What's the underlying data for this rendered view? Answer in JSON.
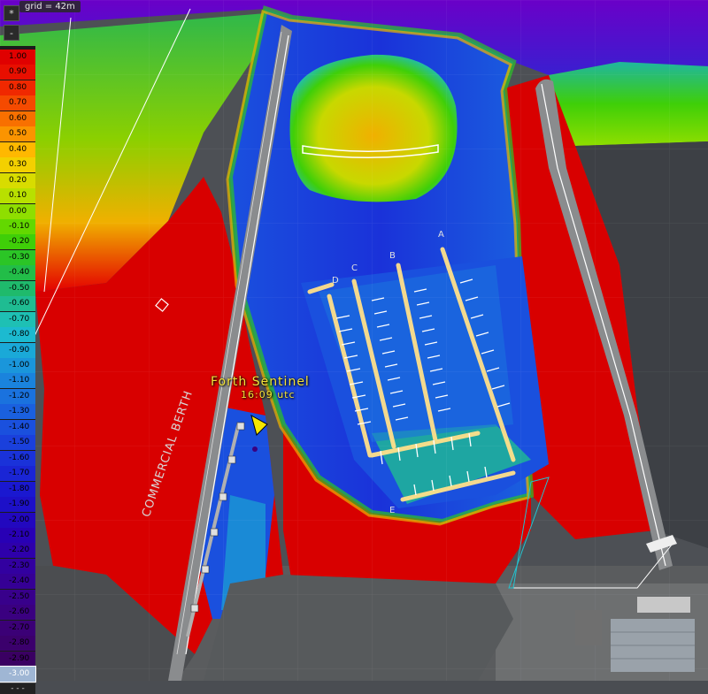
{
  "grid_label": "grid = 42m",
  "buttons": {
    "top": "*",
    "second": "-"
  },
  "legend": {
    "values": [
      "1.00",
      "0.90",
      "0.80",
      "0.70",
      "0.60",
      "0.50",
      "0.40",
      "0.30",
      "0.20",
      "0.10",
      "0.00",
      "-0.10",
      "-0.20",
      "-0.30",
      "-0.40",
      "-0.50",
      "-0.60",
      "-0.70",
      "-0.80",
      "-0.90",
      "-1.00",
      "-1.10",
      "-1.20",
      "-1.30",
      "-1.40",
      "-1.50",
      "-1.60",
      "-1.70",
      "-1.80",
      "-1.90",
      "-2.00",
      "-2.10",
      "-2.20",
      "-2.30",
      "-2.40",
      "-2.50",
      "-2.60",
      "-2.70",
      "-2.80",
      "-2.90",
      "-3.00"
    ],
    "colors": [
      "#e00000",
      "#e80f00",
      "#f02800",
      "#f54a00",
      "#f87000",
      "#fb9400",
      "#ffb800",
      "#f3d000",
      "#d8dc00",
      "#b8e000",
      "#8fde00",
      "#63d800",
      "#3fcf08",
      "#2bc526",
      "#22bd48",
      "#1fba6c",
      "#1fbc92",
      "#1ec0b4",
      "#1cbad0",
      "#1aa9d8",
      "#1a96db",
      "#1a83dd",
      "#1a72de",
      "#1a60df",
      "#1a50de",
      "#1a40dc",
      "#1a32d9",
      "#1a25d5",
      "#1a18d0",
      "#1d10c8",
      "#2208bf",
      "#2800b5",
      "#2e00ab",
      "#3200a0",
      "#350095",
      "#38008b",
      "#3a0080",
      "#3b0076",
      "#3b006c",
      "#3a0062",
      "#9fb6d4"
    ],
    "selected_index": 40,
    "more": "- - -"
  },
  "vessel": {
    "name": "Forth Sentinel",
    "time": "16:09 utc"
  },
  "berth_label": "COMMERCIAL BERTH",
  "pontoon_labels": [
    "A",
    "B",
    "C",
    "D",
    "E"
  ]
}
